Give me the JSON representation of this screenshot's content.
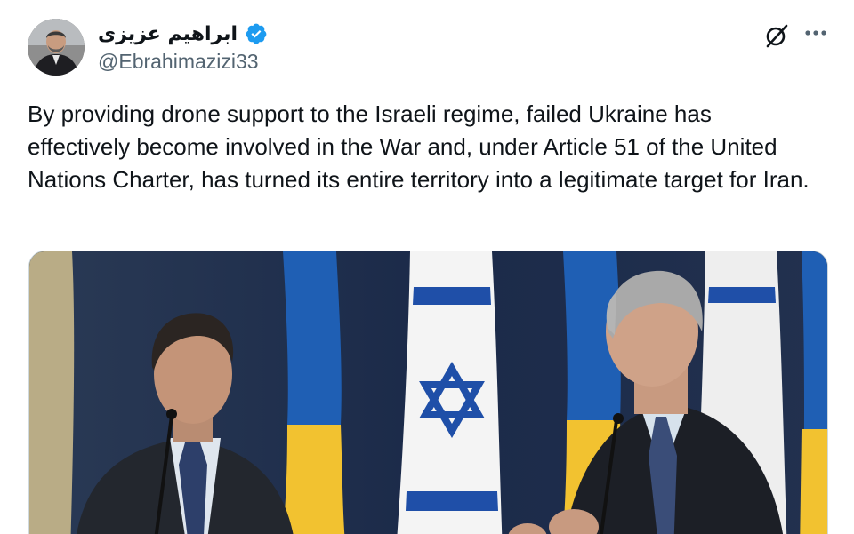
{
  "author": {
    "display_name": "ابراهیم عزیزی",
    "handle": "@Ebrahimazizi33",
    "verified": true,
    "avatar_icon": "profile-photo"
  },
  "header_actions": {
    "grok_icon": "grok-icon",
    "more_icon": "more-options-icon"
  },
  "tweet": {
    "text": "By providing drone support to the Israeli regime, failed Ukraine has effectively become involved in the War and, under Article 51 of the United Nations Charter, has turned its entire territory into a legitimate target for Iran."
  },
  "media": {
    "type": "photo"
  },
  "colors": {
    "verified_blue": "#1d9bf0",
    "text_primary": "#0f1419",
    "text_secondary": "#536471",
    "ukraine_blue": "#1f5fb4",
    "ukraine_yellow": "#f2c230",
    "israel_blue": "#1f4fa8"
  }
}
